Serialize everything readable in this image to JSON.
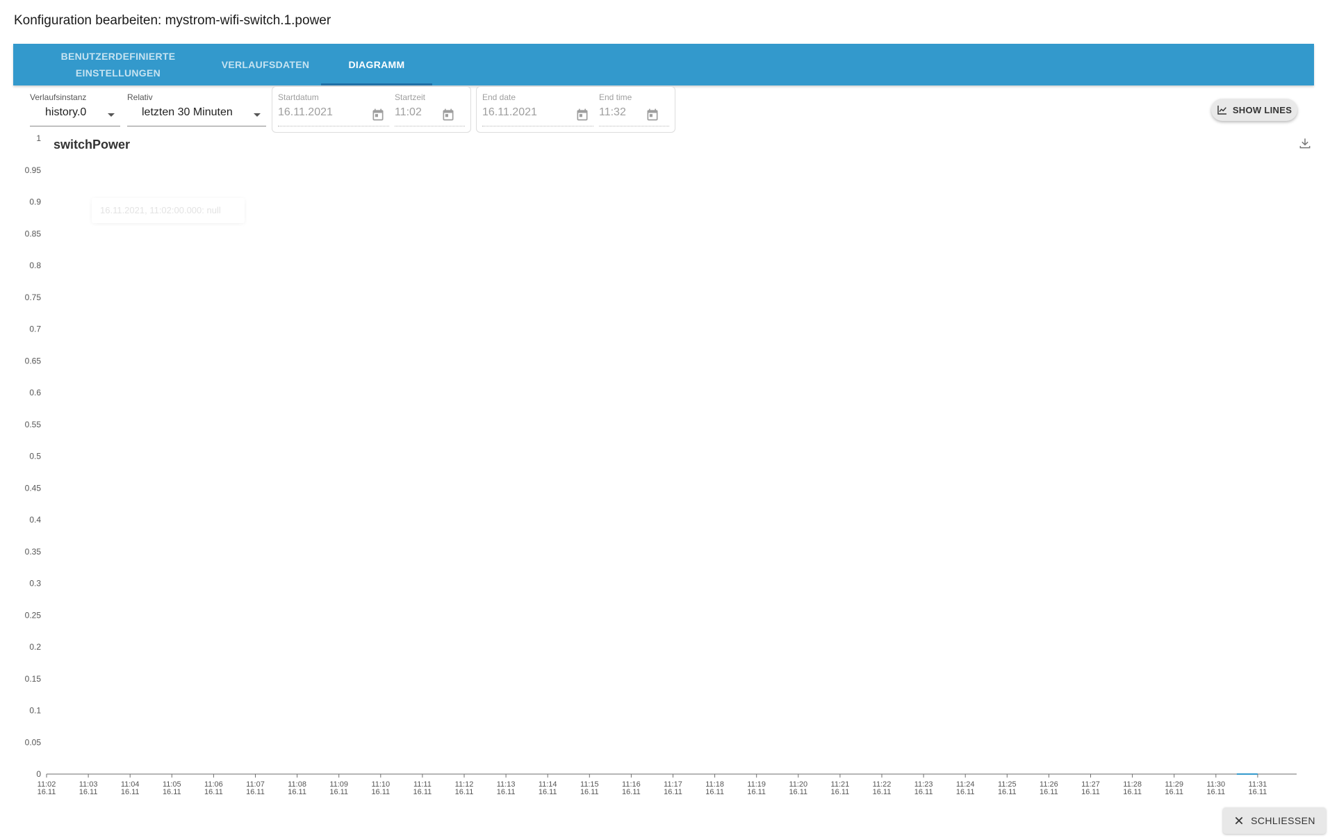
{
  "dialog": {
    "title": "Konfiguration bearbeiten: mystrom-wifi-switch.1.power"
  },
  "tabs": [
    {
      "label": "BENUTZERDEFINIERTE\nEINSTELLUNGEN",
      "active": false
    },
    {
      "label": "VERLAUFSDATEN",
      "active": false
    },
    {
      "label": "DIAGRAMM",
      "active": true
    }
  ],
  "controls": {
    "instance": {
      "label": "Verlaufsinstanz",
      "value": "history.0"
    },
    "relative": {
      "label": "Relativ",
      "value": "letzten 30 Minuten"
    },
    "start_date": {
      "label": "Startdatum",
      "value": "16.11.2021"
    },
    "start_time": {
      "label": "Startzeit",
      "value": "11:02"
    },
    "end_date": {
      "label": "End date",
      "value": "16.11.2021"
    },
    "end_time": {
      "label": "End time",
      "value": "11:32"
    },
    "show_lines_label": "SHOW LINES"
  },
  "colors": {
    "tabbar": "#3399cc",
    "series": "#3399cc"
  },
  "chart_data": {
    "type": "line",
    "title": "switchPower",
    "xlabel": "",
    "ylabel": "",
    "ylim": [
      0,
      1
    ],
    "y_ticks": [
      "0",
      "0.05",
      "0.1",
      "0.15",
      "0.2",
      "0.25",
      "0.3",
      "0.35",
      "0.4",
      "0.45",
      "0.5",
      "0.55",
      "0.6",
      "0.65",
      "0.7",
      "0.75",
      "0.8",
      "0.85",
      "0.9",
      "0.95",
      "1"
    ],
    "x_time_labels": [
      "11:02",
      "11:03",
      "11:04",
      "11:05",
      "11:06",
      "11:07",
      "11:08",
      "11:09",
      "11:10",
      "11:11",
      "11:12",
      "11:13",
      "11:14",
      "11:15",
      "11:16",
      "11:17",
      "11:18",
      "11:19",
      "11:20",
      "11:21",
      "11:22",
      "11:23",
      "11:24",
      "11:25",
      "11:26",
      "11:27",
      "11:28",
      "11:29",
      "11:30",
      "11:31"
    ],
    "x_date_label": "16.11",
    "series": [
      {
        "x": [
          "11:30:30",
          "11:31"
        ],
        "values": [
          0,
          0
        ]
      }
    ],
    "tooltip": "16.11.2021, 11:02:00.000: null",
    "grid": false
  },
  "footer": {
    "close_label": "SCHLIESSEN"
  }
}
